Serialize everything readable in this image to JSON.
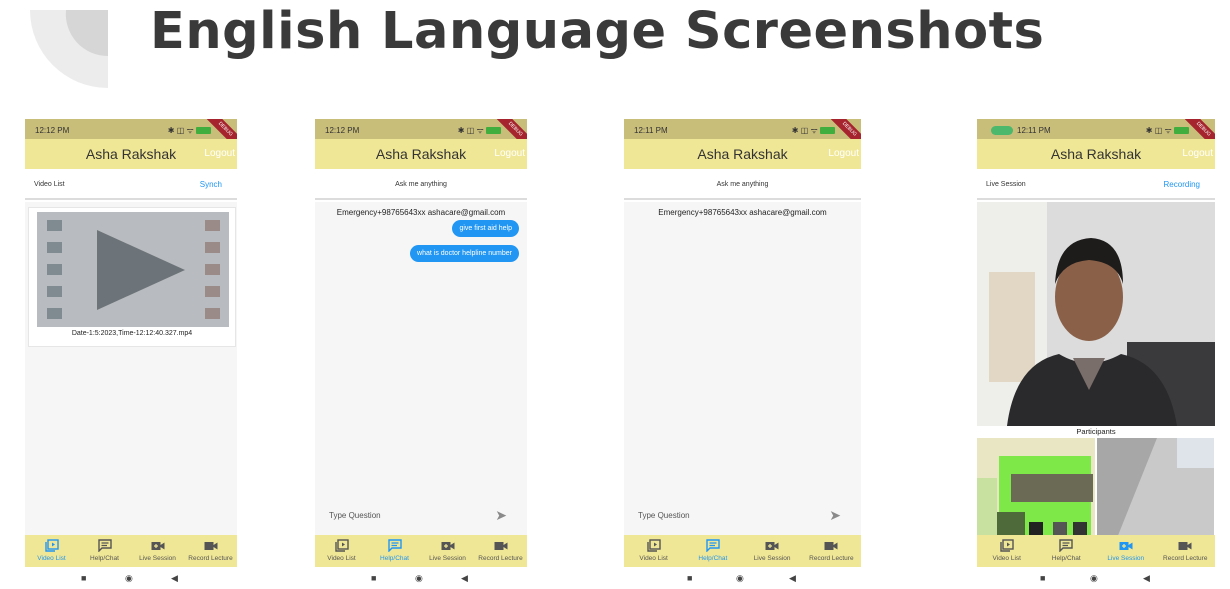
{
  "page": {
    "title": "English Language Screenshots"
  },
  "phones": [
    {
      "status_time": "12:12 PM",
      "app_title": "Asha Rakshak",
      "logout_label": "Logout",
      "sub_left": "Video List",
      "sub_right": "Synch",
      "video_name": "Date-1:5:2023,Time-12:12:40.327.mp4",
      "nav": [
        "Video List",
        "Help/Chat",
        "Live Session",
        "Record Lecture"
      ],
      "active_tab": "Video List"
    },
    {
      "status_time": "12:12 PM",
      "app_title": "Asha Rakshak",
      "logout_label": "Logout",
      "sub_center": "Ask me anything",
      "contact": "Emergency+98765643xx ashacare@gmail.com",
      "messages": [
        "give first aid help",
        "what is doctor helpline number"
      ],
      "input_placeholder": "Type Question",
      "nav": [
        "Video List",
        "Help/Chat",
        "Live Session",
        "Record Lecture"
      ],
      "active_tab": "Help/Chat"
    },
    {
      "status_time": "12:11 PM",
      "app_title": "Asha Rakshak",
      "logout_label": "Logout",
      "sub_center": "Ask me anything",
      "contact": "Emergency+98765643xx ashacare@gmail.com",
      "input_placeholder": "Type Question",
      "nav": [
        "Video List",
        "Help/Chat",
        "Live Session",
        "Record Lecture"
      ],
      "active_tab": "Help/Chat"
    },
    {
      "status_time": "12:11 PM",
      "app_title": "Asha Rakshak",
      "logout_label": "Logout",
      "sub_left": "Live Session",
      "sub_right": "Recording",
      "participants_label": "Participants",
      "nav": [
        "Video List",
        "Help/Chat",
        "Live Session",
        "Record Lecture"
      ],
      "active_tab": "Live Session"
    }
  ],
  "colors": {
    "appbar": "#f0e796",
    "statusbar": "#c9bd7a",
    "accent": "#2196f3",
    "debug_ribbon": "#a5242e"
  },
  "icons": [
    "video-library-icon",
    "chat-icon",
    "video-call-icon",
    "videocam-icon",
    "send-icon",
    "play-icon",
    "square-nav-icon",
    "circle-nav-icon",
    "back-nav-icon"
  ]
}
